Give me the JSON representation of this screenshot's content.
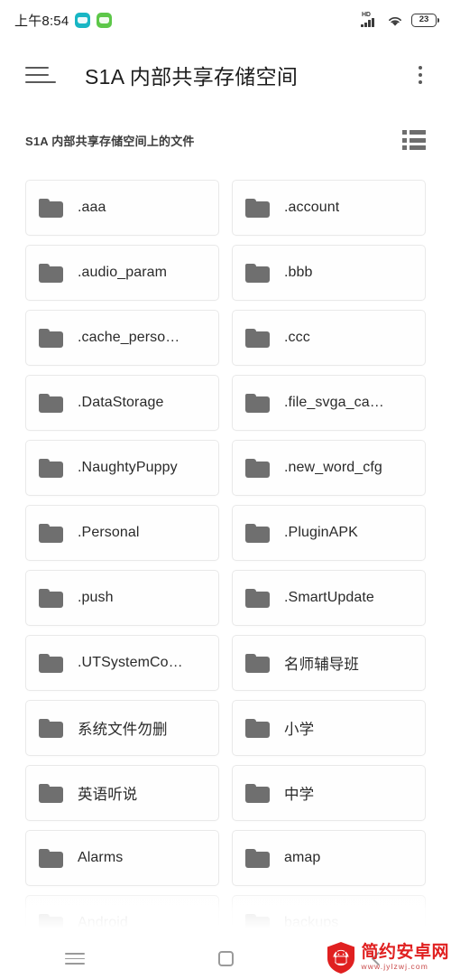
{
  "statusbar": {
    "time": "上午8:54",
    "app_icons": [
      {
        "name": "notification-app-icon-teal",
        "color": "#18b6c4"
      },
      {
        "name": "notification-app-icon-green",
        "color": "#5dc749"
      }
    ],
    "signal_label": "HD",
    "battery_percent": "23"
  },
  "appbar": {
    "menu_icon": "hamburger-menu-icon",
    "title": "S1A 内部共享存储空间",
    "overflow_icon": "more-vert-icon"
  },
  "subheader": {
    "label": "S1A 内部共享存储空间上的文件",
    "view_toggle_icon": "list-view-icon"
  },
  "files": [
    {
      "name": ".aaa",
      "type": "folder",
      "cjk": false
    },
    {
      "name": ".account",
      "type": "folder",
      "cjk": false
    },
    {
      "name": ".audio_param",
      "type": "folder",
      "cjk": false
    },
    {
      "name": ".bbb",
      "type": "folder",
      "cjk": false
    },
    {
      "name": ".cache_perso…",
      "type": "folder",
      "cjk": false
    },
    {
      "name": ".ccc",
      "type": "folder",
      "cjk": false
    },
    {
      "name": ".DataStorage",
      "type": "folder",
      "cjk": false
    },
    {
      "name": ".file_svga_ca…",
      "type": "folder",
      "cjk": false
    },
    {
      "name": ".NaughtyPuppy",
      "type": "folder",
      "cjk": false
    },
    {
      "name": ".new_word_cfg",
      "type": "folder",
      "cjk": false
    },
    {
      "name": ".Personal",
      "type": "folder",
      "cjk": false
    },
    {
      "name": ".PluginAPK",
      "type": "folder",
      "cjk": false
    },
    {
      "name": ".push",
      "type": "folder",
      "cjk": false
    },
    {
      "name": ".SmartUpdate",
      "type": "folder",
      "cjk": false
    },
    {
      "name": ".UTSystemCo…",
      "type": "folder",
      "cjk": false
    },
    {
      "name": "名师辅导班",
      "type": "folder",
      "cjk": true
    },
    {
      "name": "系统文件勿删",
      "type": "folder",
      "cjk": true
    },
    {
      "name": "小学",
      "type": "folder",
      "cjk": true
    },
    {
      "name": "英语听说",
      "type": "folder",
      "cjk": true
    },
    {
      "name": "中学",
      "type": "folder",
      "cjk": true
    },
    {
      "name": "Alarms",
      "type": "folder",
      "cjk": false
    },
    {
      "name": "amap",
      "type": "folder",
      "cjk": false
    },
    {
      "name": "Android",
      "type": "folder",
      "cjk": false
    },
    {
      "name": "backups",
      "type": "folder",
      "cjk": false
    }
  ],
  "navbar": {
    "recents_icon": "recents-icon",
    "home_icon": "home-square-icon",
    "back_icon": "back-chevron-icon"
  },
  "watermark": {
    "title": "简约安卓网",
    "url": "www.jylzwj.com",
    "logo_icon": "android-shield-logo",
    "color": "#e02020"
  },
  "colors": {
    "background": "#ffffff",
    "card_border": "#e9e9e9",
    "folder_icon": "#6f6f6f",
    "text_primary": "#1d1d1d",
    "text_secondary": "#3c3c3c",
    "nav_icon": "#9a9a9a"
  }
}
